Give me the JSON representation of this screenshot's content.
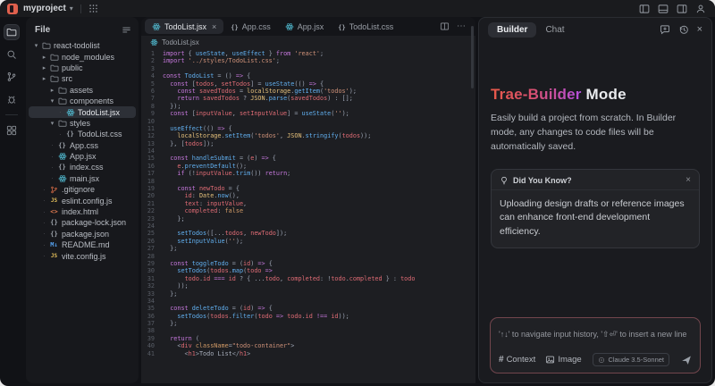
{
  "titlebar": {
    "project": "myproject",
    "right_icons": [
      "panel-left",
      "panel-bottom",
      "panel-right",
      "account"
    ]
  },
  "activity_bar": {
    "items": [
      {
        "name": "files",
        "active": true
      },
      {
        "name": "search"
      },
      {
        "name": "source-control"
      },
      {
        "name": "debug"
      },
      {
        "name": "extensions"
      }
    ]
  },
  "sidebar": {
    "header": "File",
    "tree": [
      {
        "label": "react-todolist",
        "icon": "folder",
        "depth": 0,
        "chevron": "open"
      },
      {
        "label": "node_modules",
        "icon": "folder",
        "depth": 1,
        "chevron": "closed"
      },
      {
        "label": "public",
        "icon": "folder",
        "depth": 1,
        "chevron": "closed"
      },
      {
        "label": "src",
        "icon": "folder",
        "depth": 1,
        "chevron": "closed"
      },
      {
        "label": "assets",
        "icon": "folder",
        "depth": 2,
        "chevron": "closed"
      },
      {
        "label": "components",
        "icon": "folder",
        "depth": 2,
        "chevron": "open"
      },
      {
        "label": "TodoList.jsx",
        "icon": "react",
        "depth": 3,
        "selected": true
      },
      {
        "label": "styles",
        "icon": "folder",
        "depth": 2,
        "chevron": "open"
      },
      {
        "label": "TodoList.css",
        "icon": "braces",
        "depth": 3
      },
      {
        "label": "App.css",
        "icon": "braces",
        "depth": 2
      },
      {
        "label": "App.jsx",
        "icon": "react",
        "depth": 2
      },
      {
        "label": "index.css",
        "icon": "braces",
        "depth": 2
      },
      {
        "label": "main.jsx",
        "icon": "react",
        "depth": 2
      },
      {
        "label": ".gitignore",
        "icon": "git",
        "depth": 1
      },
      {
        "label": "eslint.config.js",
        "icon": "js",
        "depth": 1
      },
      {
        "label": "index.html",
        "icon": "html",
        "depth": 1
      },
      {
        "label": "package-lock.json",
        "icon": "braces",
        "depth": 1
      },
      {
        "label": "package.json",
        "icon": "braces",
        "depth": 1
      },
      {
        "label": "README.md",
        "icon": "md",
        "depth": 1
      },
      {
        "label": "vite.config.js",
        "icon": "js",
        "depth": 1
      }
    ]
  },
  "editor": {
    "tabs": [
      {
        "label": "TodoList.jsx",
        "icon": "react",
        "active": true,
        "closable": true
      },
      {
        "label": "App.css",
        "icon": "braces"
      },
      {
        "label": "App.jsx",
        "icon": "react"
      },
      {
        "label": "TodoList.css",
        "icon": "braces"
      }
    ],
    "breadcrumb": "TodoList.jsx",
    "code": [
      [
        [
          "kw",
          "import"
        ],
        [
          "pn",
          " { "
        ],
        [
          "fn",
          "useState"
        ],
        [
          "pn",
          ", "
        ],
        [
          "fn",
          "useEffect"
        ],
        [
          "pn",
          " } "
        ],
        [
          "kw",
          "from"
        ],
        [
          "str",
          " 'react'"
        ],
        [
          "pn",
          ";"
        ]
      ],
      [
        [
          "kw",
          "import "
        ],
        [
          "str",
          "'../styles/TodoList.css'"
        ],
        [
          "pn",
          ";"
        ]
      ],
      [],
      [
        [
          "kw",
          "const "
        ],
        [
          "fn",
          "TodoList"
        ],
        [
          "pn",
          " = () "
        ],
        [
          "kw",
          "=>"
        ],
        [
          "pn",
          " {"
        ]
      ],
      [
        [
          "pn",
          "  "
        ],
        [
          "kw",
          "const"
        ],
        [
          "pn",
          " ["
        ],
        [
          "var",
          "todos"
        ],
        [
          "pn",
          ", "
        ],
        [
          "var",
          "setTodos"
        ],
        [
          "pn",
          "] = "
        ],
        [
          "fn",
          "useState"
        ],
        [
          "pn",
          "(() "
        ],
        [
          "kw",
          "=>"
        ],
        [
          "pn",
          " {"
        ]
      ],
      [
        [
          "pn",
          "    "
        ],
        [
          "kw",
          "const "
        ],
        [
          "var",
          "savedTodos"
        ],
        [
          "pn",
          " = "
        ],
        [
          "obj",
          "localStorage"
        ],
        [
          "pn",
          "."
        ],
        [
          "fn",
          "getItem"
        ],
        [
          "pn",
          "("
        ],
        [
          "str",
          "'todos'"
        ],
        [
          "pn",
          ");"
        ]
      ],
      [
        [
          "pn",
          "    "
        ],
        [
          "kw",
          "return "
        ],
        [
          "var",
          "savedTodos"
        ],
        [
          "pn",
          " ? "
        ],
        [
          "obj",
          "JSON"
        ],
        [
          "pn",
          "."
        ],
        [
          "fn",
          "parse"
        ],
        [
          "pn",
          "("
        ],
        [
          "var",
          "savedTodos"
        ],
        [
          "pn",
          ") : [];"
        ]
      ],
      [
        [
          "pn",
          "  });"
        ]
      ],
      [
        [
          "pn",
          "  "
        ],
        [
          "kw",
          "const"
        ],
        [
          "pn",
          " ["
        ],
        [
          "var",
          "inputValue"
        ],
        [
          "pn",
          ", "
        ],
        [
          "var",
          "setInputValue"
        ],
        [
          "pn",
          "] = "
        ],
        [
          "fn",
          "useState"
        ],
        [
          "pn",
          "("
        ],
        [
          "str",
          "''"
        ],
        [
          "pn",
          ");"
        ]
      ],
      [],
      [
        [
          "pn",
          "  "
        ],
        [
          "fn",
          "useEffect"
        ],
        [
          "pn",
          "(() "
        ],
        [
          "kw",
          "=>"
        ],
        [
          "pn",
          " {"
        ]
      ],
      [
        [
          "pn",
          "    "
        ],
        [
          "obj",
          "localStorage"
        ],
        [
          "pn",
          "."
        ],
        [
          "fn",
          "setItem"
        ],
        [
          "pn",
          "("
        ],
        [
          "str",
          "'todos'"
        ],
        [
          "pn",
          ", "
        ],
        [
          "obj",
          "JSON"
        ],
        [
          "pn",
          "."
        ],
        [
          "fn",
          "stringify"
        ],
        [
          "pn",
          "("
        ],
        [
          "var",
          "todos"
        ],
        [
          "pn",
          "));"
        ]
      ],
      [
        [
          "pn",
          "  }, ["
        ],
        [
          "var",
          "todos"
        ],
        [
          "pn",
          "]);"
        ]
      ],
      [],
      [
        [
          "pn",
          "  "
        ],
        [
          "kw",
          "const "
        ],
        [
          "fn",
          "handleSubmit"
        ],
        [
          "pn",
          " = ("
        ],
        [
          "var",
          "e"
        ],
        [
          "pn",
          ") "
        ],
        [
          "kw",
          "=>"
        ],
        [
          "pn",
          " {"
        ]
      ],
      [
        [
          "pn",
          "    "
        ],
        [
          "var",
          "e"
        ],
        [
          "pn",
          "."
        ],
        [
          "fn",
          "preventDefault"
        ],
        [
          "pn",
          "();"
        ]
      ],
      [
        [
          "pn",
          "    "
        ],
        [
          "kw",
          "if"
        ],
        [
          "pn",
          " (!"
        ],
        [
          "var",
          "inputValue"
        ],
        [
          "pn",
          "."
        ],
        [
          "fn",
          "trim"
        ],
        [
          "pn",
          "()) "
        ],
        [
          "kw",
          "return"
        ],
        [
          "pn",
          ";"
        ]
      ],
      [],
      [
        [
          "pn",
          "    "
        ],
        [
          "kw",
          "const "
        ],
        [
          "var",
          "newTodo"
        ],
        [
          "pn",
          " = {"
        ]
      ],
      [
        [
          "pn",
          "      "
        ],
        [
          "var",
          "id"
        ],
        [
          "pn",
          ": "
        ],
        [
          "obj",
          "Date"
        ],
        [
          "pn",
          "."
        ],
        [
          "fn",
          "now"
        ],
        [
          "pn",
          "(),"
        ]
      ],
      [
        [
          "pn",
          "      "
        ],
        [
          "var",
          "text"
        ],
        [
          "pn",
          ": "
        ],
        [
          "var",
          "inputValue"
        ],
        [
          "pn",
          ","
        ]
      ],
      [
        [
          "pn",
          "      "
        ],
        [
          "var",
          "completed"
        ],
        [
          "pn",
          ": "
        ],
        [
          "num",
          "false"
        ]
      ],
      [
        [
          "pn",
          "    };"
        ]
      ],
      [],
      [
        [
          "pn",
          "    "
        ],
        [
          "fn",
          "setTodos"
        ],
        [
          "pn",
          "([..."
        ],
        [
          "var",
          "todos"
        ],
        [
          "pn",
          ", "
        ],
        [
          "var",
          "newTodo"
        ],
        [
          "pn",
          "]);"
        ]
      ],
      [
        [
          "pn",
          "    "
        ],
        [
          "fn",
          "setInputValue"
        ],
        [
          "pn",
          "("
        ],
        [
          "str",
          "''"
        ],
        [
          "pn",
          ");"
        ]
      ],
      [
        [
          "pn",
          "  };"
        ]
      ],
      [],
      [
        [
          "pn",
          "  "
        ],
        [
          "kw",
          "const "
        ],
        [
          "fn",
          "toggleTodo"
        ],
        [
          "pn",
          " = ("
        ],
        [
          "var",
          "id"
        ],
        [
          "pn",
          ") "
        ],
        [
          "kw",
          "=>"
        ],
        [
          "pn",
          " {"
        ]
      ],
      [
        [
          "pn",
          "    "
        ],
        [
          "fn",
          "setTodos"
        ],
        [
          "pn",
          "("
        ],
        [
          "var",
          "todos"
        ],
        [
          "pn",
          "."
        ],
        [
          "fn",
          "map"
        ],
        [
          "pn",
          "("
        ],
        [
          "var",
          "todo"
        ],
        [
          "pn",
          " "
        ],
        [
          "kw",
          "=>"
        ]
      ],
      [
        [
          "pn",
          "      "
        ],
        [
          "var",
          "todo"
        ],
        [
          "pn",
          "."
        ],
        [
          "var",
          "id"
        ],
        [
          "pn",
          " "
        ],
        [
          "kw",
          "==="
        ],
        [
          "pn",
          " "
        ],
        [
          "var",
          "id"
        ],
        [
          "pn",
          " ? { ..."
        ],
        [
          "var",
          "todo"
        ],
        [
          "pn",
          ", "
        ],
        [
          "var",
          "completed"
        ],
        [
          "pn",
          ": !"
        ],
        [
          "var",
          "todo"
        ],
        [
          "pn",
          "."
        ],
        [
          "var",
          "completed"
        ],
        [
          "pn",
          " } : "
        ],
        [
          "var",
          "todo"
        ]
      ],
      [
        [
          "pn",
          "    ));"
        ]
      ],
      [
        [
          "pn",
          "  };"
        ]
      ],
      [],
      [
        [
          "pn",
          "  "
        ],
        [
          "kw",
          "const "
        ],
        [
          "fn",
          "deleteTodo"
        ],
        [
          "pn",
          " = ("
        ],
        [
          "var",
          "id"
        ],
        [
          "pn",
          ") "
        ],
        [
          "kw",
          "=>"
        ],
        [
          "pn",
          " {"
        ]
      ],
      [
        [
          "pn",
          "    "
        ],
        [
          "fn",
          "setTodos"
        ],
        [
          "pn",
          "("
        ],
        [
          "var",
          "todos"
        ],
        [
          "pn",
          "."
        ],
        [
          "fn",
          "filter"
        ],
        [
          "pn",
          "("
        ],
        [
          "var",
          "todo"
        ],
        [
          "pn",
          " "
        ],
        [
          "kw",
          "=>"
        ],
        [
          "pn",
          " "
        ],
        [
          "var",
          "todo"
        ],
        [
          "pn",
          "."
        ],
        [
          "var",
          "id"
        ],
        [
          "pn",
          " "
        ],
        [
          "kw",
          "!=="
        ],
        [
          "pn",
          " "
        ],
        [
          "var",
          "id"
        ],
        [
          "pn",
          "));"
        ]
      ],
      [
        [
          "pn",
          "  };"
        ]
      ],
      [],
      [
        [
          "pn",
          "  "
        ],
        [
          "kw",
          "return"
        ],
        [
          "pn",
          " ("
        ]
      ],
      [
        [
          "pn",
          "    <"
        ],
        [
          "tag",
          "div"
        ],
        [
          "pn",
          " "
        ],
        [
          "attr",
          "className"
        ],
        [
          "pn",
          "="
        ],
        [
          "str",
          "\"todo-container\""
        ],
        [
          "pn",
          ">"
        ]
      ],
      [
        [
          "pn",
          "      <"
        ],
        [
          "tag",
          "h1"
        ],
        [
          "pn",
          ">"
        ],
        [
          "txt",
          "Todo List"
        ],
        [
          "pn",
          "</"
        ],
        [
          "tag",
          "h1"
        ],
        [
          "pn",
          ">"
        ]
      ]
    ]
  },
  "builder": {
    "tabs": {
      "builder": "Builder",
      "chat": "Chat"
    },
    "header_icons": [
      "new-chat",
      "history",
      "close"
    ],
    "heading": {
      "gradient": "Trae-Builder",
      "rest": "Mode"
    },
    "subtitle": "Easily build a project from scratch. In Builder mode, any changes to code files will be automatically saved.",
    "tip": {
      "title": "Did You Know?",
      "body": "Uploading design drafts or reference images can enhance front-end development efficiency.",
      "close": "×"
    },
    "input": {
      "placeholder": "'↑↓' to navigate input history, '⇧⏎' to insert a new line",
      "context_label": "Context",
      "image_label": "Image",
      "model": "Claude 3.5-Sonnet"
    }
  },
  "colors": {
    "accent_gradient_start": "#e85948",
    "accent_gradient_end": "#b44fe0",
    "logo": "#e0604d",
    "react_icon": "#53c1d8"
  }
}
